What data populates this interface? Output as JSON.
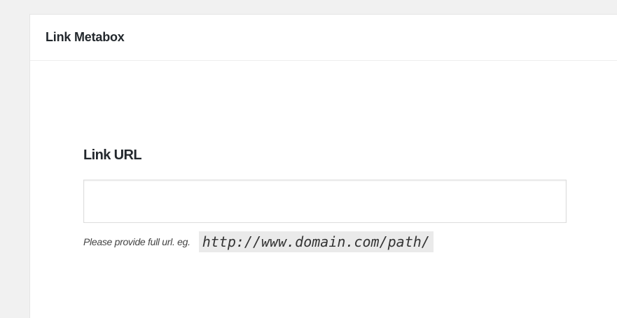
{
  "metabox": {
    "title": "Link Metabox"
  },
  "field": {
    "label": "Link URL",
    "value": "",
    "placeholder": "",
    "help_text": "Please provide full url. eg.",
    "help_example": "http://www.domain.com/path/"
  }
}
